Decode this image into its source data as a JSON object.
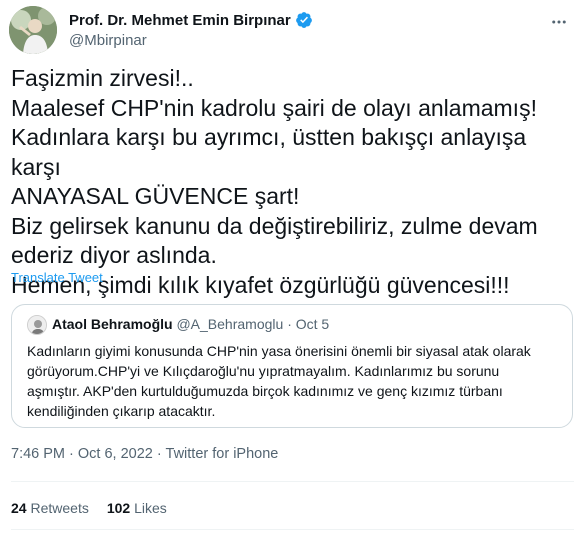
{
  "author": {
    "display_name": "Prof. Dr. Mehmet Emin Birpınar",
    "handle": "@Mbirpinar",
    "verified": true,
    "avatar_icon": "profile-photo"
  },
  "tweet": {
    "text": "Faşizmin zirvesi!..\nMaalesef CHP'nin kadrolu şairi de olayı anlamamış!\nKadınlara karşı bu ayrımcı, üstten bakışçı anlayışa karşı\nANAYASAL GÜVENCE şart!\nBiz gelirsek kanunu da değiştirebiliriz, zulme devam\nederiz diyor aslında.\nHemen, şimdi kılık kıyafet özgürlüğü güvencesi!!!",
    "translate_label": "Translate Tweet"
  },
  "quoted": {
    "name": "Ataol Behramoğlu",
    "handle": "@A_Behramoglu",
    "separator": "·",
    "date": "Oct 5",
    "text": "Kadınların giyimi konusunda CHP'nin yasa önerisini önemli bir siyasal atak olarak\ngörüyorum.CHP'yi ve Kılıçdaroğlu'nu yıpratmayalım. Kadınlarımız bu sorunu\naşmıştır. AKP'den kurtulduğumuzda birçok kadınımız ve genç kızımız türbanı\nkendiliğinden çıkarıp atacaktır."
  },
  "meta": {
    "time": "7:46 PM",
    "date": "Oct 6, 2022",
    "separator": "·",
    "source": "Twitter for iPhone"
  },
  "stats": {
    "retweets_count": "24",
    "retweets_label": "Retweets",
    "likes_count": "102",
    "likes_label": "Likes"
  },
  "colors": {
    "accent": "#1d9bf0",
    "text": "#0f1419",
    "secondary": "#536471",
    "border": "#cfd9de"
  }
}
